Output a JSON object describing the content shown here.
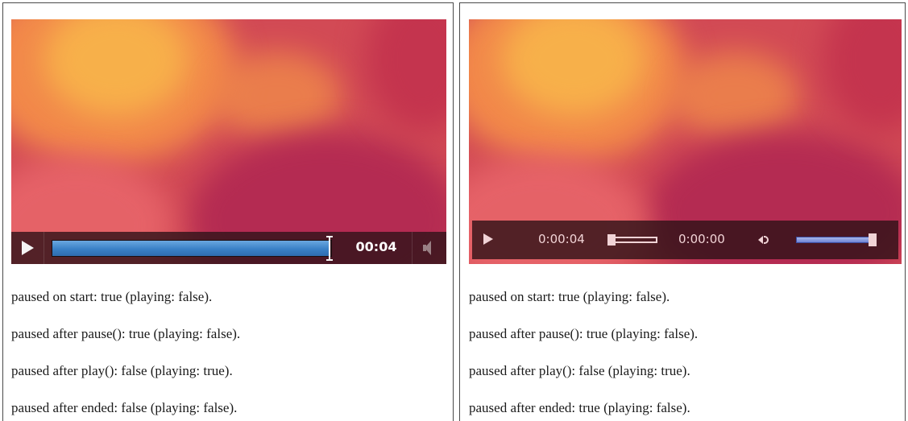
{
  "left_panel": {
    "player": {
      "time": "00:04",
      "progress": 0.99
    },
    "status_lines": [
      "paused on start: true (playing: false).",
      "paused after pause(): true (playing: false).",
      "paused after play(): false (playing: true).",
      "paused after ended: false (playing: false)."
    ]
  },
  "right_panel": {
    "player": {
      "current_time": "0:00:04",
      "remaining_time": "0:00:00",
      "seek_position": 0.0,
      "volume": 1.0
    },
    "status_lines": [
      "paused on start: true (playing: false).",
      "paused after pause(): true (playing: false).",
      "paused after play(): false (playing: true).",
      "paused after ended: true (playing: false)."
    ]
  },
  "colors": {
    "video_base": "#d24a55",
    "video_glow": "#f6a84a",
    "progress_fill": "#3a80c6",
    "volume_fill": "#6f83d6"
  }
}
